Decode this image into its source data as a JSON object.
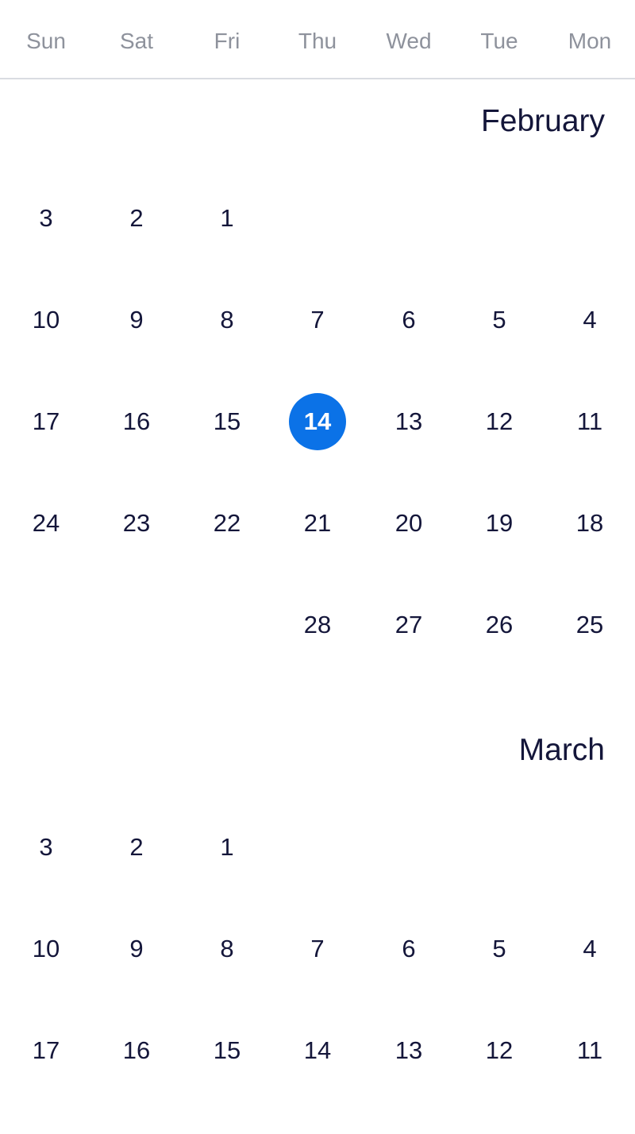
{
  "weekdays": [
    "Sun",
    "Sat",
    "Fri",
    "Thu",
    "Wed",
    "Tue",
    "Mon"
  ],
  "accent_color": "#0b72e7",
  "selected": {
    "month": "February",
    "day": "14"
  },
  "months": [
    {
      "name": "February",
      "weeks": [
        [
          "3",
          "2",
          "1",
          "",
          "",
          "",
          ""
        ],
        [
          "10",
          "9",
          "8",
          "7",
          "6",
          "5",
          "4"
        ],
        [
          "17",
          "16",
          "15",
          "14",
          "13",
          "12",
          "11"
        ],
        [
          "24",
          "23",
          "22",
          "21",
          "20",
          "19",
          "18"
        ],
        [
          "",
          "",
          "",
          "28",
          "27",
          "26",
          "25"
        ]
      ]
    },
    {
      "name": "March",
      "weeks": [
        [
          "3",
          "2",
          "1",
          "",
          "",
          "",
          ""
        ],
        [
          "10",
          "9",
          "8",
          "7",
          "6",
          "5",
          "4"
        ],
        [
          "17",
          "16",
          "15",
          "14",
          "13",
          "12",
          "11"
        ]
      ]
    }
  ]
}
